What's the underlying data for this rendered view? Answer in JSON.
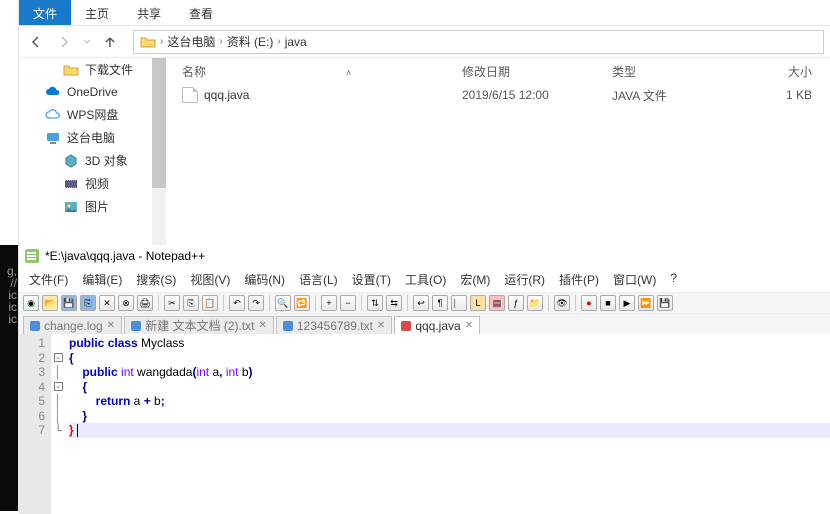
{
  "explorer": {
    "tabs": {
      "file": "文件",
      "home": "主页",
      "share": "共享",
      "view": "查看"
    },
    "breadcrumb": [
      "这台电脑",
      "资料 (E:)",
      "java"
    ],
    "cols": {
      "name": "名称",
      "date": "修改日期",
      "type": "类型",
      "size": "大小"
    },
    "files": [
      {
        "name": "qqq.java",
        "date": "2019/6/15 12:00",
        "type": "JAVA 文件",
        "size": "1 KB"
      }
    ],
    "sidebar": [
      {
        "label": "下载文件",
        "icon": "folder",
        "indent": true
      },
      {
        "label": "OneDrive",
        "icon": "cloud-blue"
      },
      {
        "label": "WPS网盘",
        "icon": "cloud-outline"
      },
      {
        "label": "这台电脑",
        "icon": "pc"
      },
      {
        "label": "3D 对象",
        "icon": "cube",
        "indent": true
      },
      {
        "label": "视频",
        "icon": "video",
        "indent": true
      },
      {
        "label": "图片",
        "icon": "image",
        "indent": true
      }
    ]
  },
  "notepad": {
    "title": "*E:\\java\\qqq.java - Notepad++",
    "menu": [
      "文件(F)",
      "编辑(E)",
      "搜索(S)",
      "视图(V)",
      "编码(N)",
      "语言(L)",
      "设置(T)",
      "工具(O)",
      "宏(M)",
      "运行(R)",
      "插件(P)",
      "窗口(W)",
      "?"
    ],
    "tabs": [
      {
        "label": "change.log",
        "active": false,
        "color": "blue"
      },
      {
        "label": "新建 文本文档 (2).txt",
        "active": false,
        "color": "blue"
      },
      {
        "label": "123456789.txt",
        "active": false,
        "color": "blue"
      },
      {
        "label": "qqq.java",
        "active": true,
        "color": "red"
      }
    ],
    "code_tokens": [
      [
        {
          "t": "public",
          "c": "kw"
        },
        {
          "t": " ",
          "c": "nm"
        },
        {
          "t": "class",
          "c": "kw"
        },
        {
          "t": " Myclass",
          "c": "nm"
        }
      ],
      [
        {
          "t": "{",
          "c": "op"
        }
      ],
      [
        {
          "t": "    ",
          "c": "nm"
        },
        {
          "t": "public",
          "c": "kw"
        },
        {
          "t": " ",
          "c": "nm"
        },
        {
          "t": "int",
          "c": "ty"
        },
        {
          "t": " wangdada",
          "c": "nm"
        },
        {
          "t": "(",
          "c": "op"
        },
        {
          "t": "int",
          "c": "ty"
        },
        {
          "t": " a",
          "c": "nm"
        },
        {
          "t": ",",
          "c": "op"
        },
        {
          "t": " ",
          "c": "nm"
        },
        {
          "t": "int",
          "c": "ty"
        },
        {
          "t": " b",
          "c": "nm"
        },
        {
          "t": ")",
          "c": "op"
        }
      ],
      [
        {
          "t": "    ",
          "c": "nm"
        },
        {
          "t": "{",
          "c": "op"
        }
      ],
      [
        {
          "t": "        ",
          "c": "nm"
        },
        {
          "t": "return",
          "c": "kw"
        },
        {
          "t": " a ",
          "c": "nm"
        },
        {
          "t": "+",
          "c": "op"
        },
        {
          "t": " b",
          "c": "nm"
        },
        {
          "t": ";",
          "c": "op"
        }
      ],
      [
        {
          "t": "    ",
          "c": "nm"
        },
        {
          "t": "}",
          "c": "op"
        }
      ],
      [
        {
          "t": "}",
          "c": "br"
        },
        {
          "t": " ",
          "c": "nm"
        }
      ]
    ],
    "fold": [
      "",
      "⊟",
      "│",
      "⊟",
      "│",
      "│",
      "└"
    ]
  }
}
